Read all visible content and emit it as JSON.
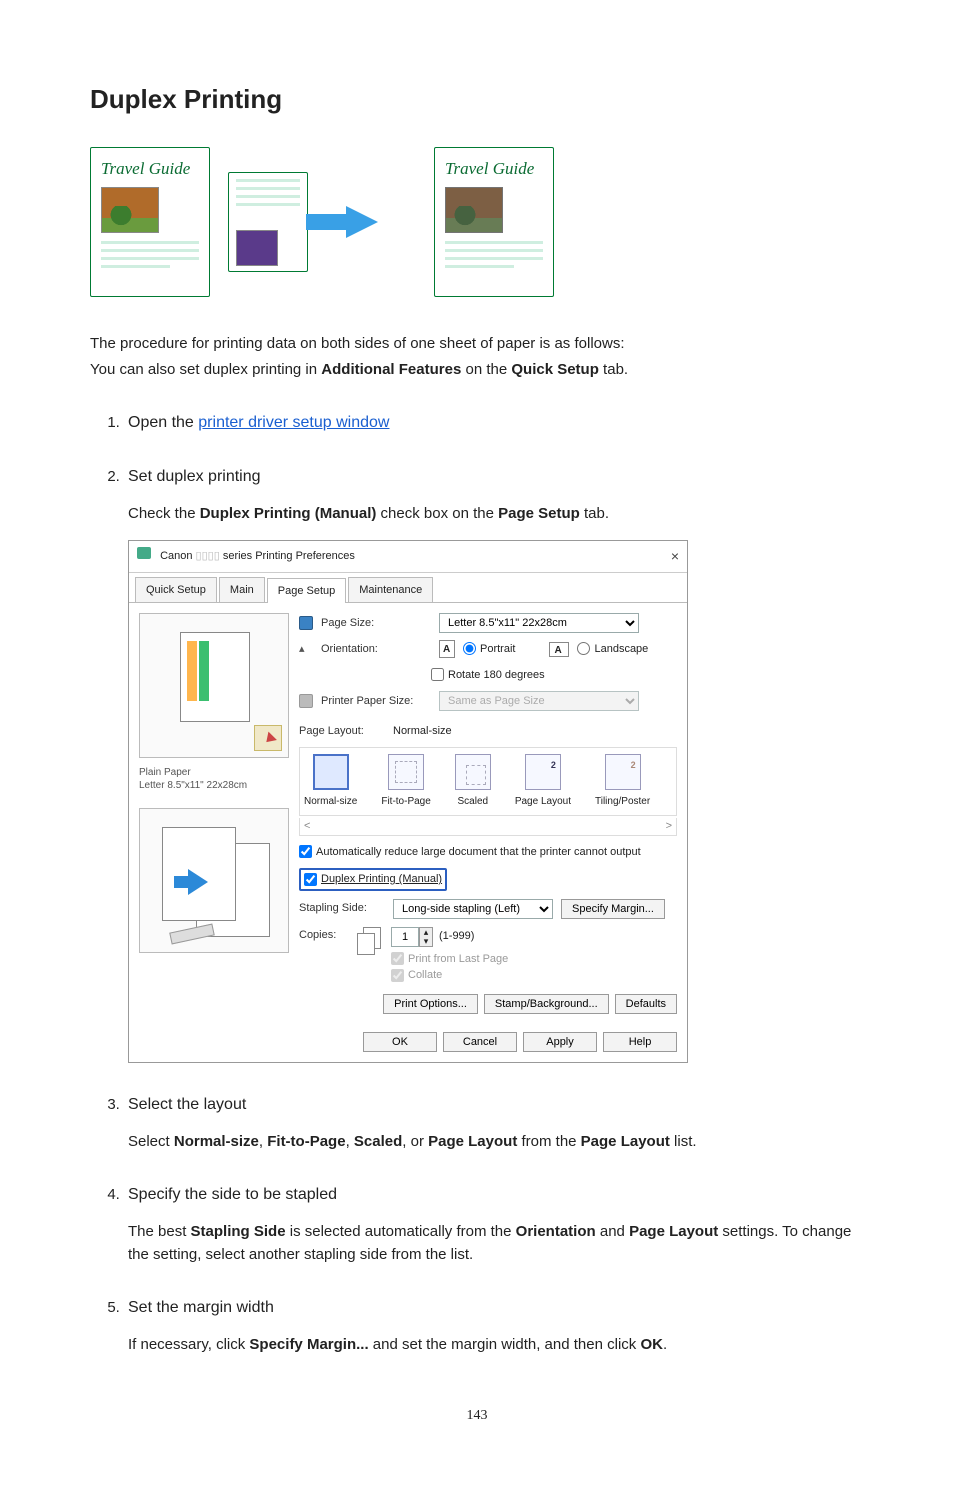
{
  "page_title": "Duplex Printing",
  "illustration": {
    "card_title": "Travel Guide"
  },
  "intro": {
    "line1": "The procedure for printing data on both sides of one sheet of paper is as follows:",
    "line2_prefix": "You can also set duplex printing in ",
    "line2_b1": "Additional Features",
    "line2_mid": " on the ",
    "line2_b2": "Quick Setup",
    "line2_suffix": " tab."
  },
  "steps": {
    "s1": {
      "prefix": "Open the ",
      "link": "printer driver setup window"
    },
    "s2": {
      "title": "Set duplex printing",
      "body_prefix": "Check the ",
      "body_b1": "Duplex Printing (Manual)",
      "body_mid": " check box on the ",
      "body_b2": "Page Setup",
      "body_suffix": " tab."
    },
    "s3": {
      "title": "Select the layout",
      "body_prefix": "Select ",
      "b1": "Normal-size",
      "c1": ", ",
      "b2": "Fit-to-Page",
      "c2": ", ",
      "b3": "Scaled",
      "c3": ", or ",
      "b4": "Page Layout",
      "mid": " from the ",
      "b5": "Page Layout",
      "suffix": " list."
    },
    "s4": {
      "title": "Specify the side to be stapled",
      "body_prefix": "The best ",
      "b1": "Stapling Side",
      "mid1": " is selected automatically from the ",
      "b2": "Orientation",
      "mid2": " and ",
      "b3": "Page Layout",
      "suffix": " settings. To change the setting, select another stapling side from the list."
    },
    "s5": {
      "title": "Set the margin width",
      "body_prefix": "If necessary, click ",
      "b1": "Specify Margin...",
      "mid": " and set the margin width, and then click ",
      "b2": "OK",
      "suffix": "."
    }
  },
  "dialog": {
    "title_prefix": "Canon ",
    "title_suffix": " series Printing Preferences",
    "tabs": [
      "Quick Setup",
      "Main",
      "Page Setup",
      "Maintenance"
    ],
    "active_tab": "Page Setup",
    "preview_media": "Plain Paper",
    "preview_size": "Letter 8.5\"x11\" 22x28cm",
    "page_size_label": "Page Size:",
    "page_size_value": "Letter 8.5\"x11\" 22x28cm",
    "orientation_label": "Orientation:",
    "orientation_portrait": "Portrait",
    "orientation_landscape": "Landscape",
    "rotate_label": "Rotate 180 degrees",
    "printer_paper_label": "Printer Paper Size:",
    "printer_paper_value": "Same as Page Size",
    "page_layout_label": "Page Layout:",
    "page_layout_value": "Normal-size",
    "layouts": [
      "Normal-size",
      "Fit-to-Page",
      "Scaled",
      "Page Layout",
      "Tiling/Poster"
    ],
    "auto_reduce_label": "Automatically reduce large document that the printer cannot output",
    "duplex_label": "Duplex Printing (Manual)",
    "stapling_label": "Stapling Side:",
    "stapling_value": "Long-side stapling (Left)",
    "specify_margin_btn": "Specify Margin...",
    "copies_label": "Copies:",
    "copies_value": "1",
    "copies_range": "(1-999)",
    "print_last_label": "Print from Last Page",
    "collate_label": "Collate",
    "print_options_btn": "Print Options...",
    "stamp_btn": "Stamp/Background...",
    "defaults_btn": "Defaults",
    "ok_btn": "OK",
    "cancel_btn": "Cancel",
    "apply_btn": "Apply",
    "help_btn": "Help"
  },
  "page_number": "143"
}
